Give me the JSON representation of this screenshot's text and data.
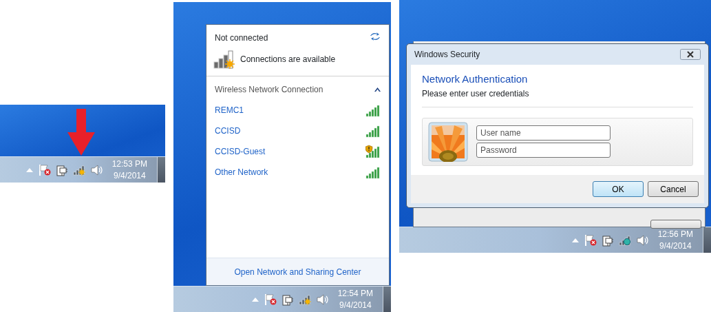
{
  "screens": [
    {
      "kind": "tray",
      "taskbar": {
        "network": {
          "kind": "available"
        },
        "time": "12:53 PM",
        "date": "9/4/2014"
      }
    },
    {
      "kind": "flyout",
      "flyout": {
        "status": "Not connected",
        "availability": "Connections are available",
        "section": {
          "title": "Wireless Network Connection",
          "expanded": true
        },
        "networks": [
          {
            "name": "REMC1",
            "warning": false
          },
          {
            "name": "CCISD",
            "warning": false
          },
          {
            "name": "CCISD-Guest",
            "warning": true
          },
          {
            "name": "Other Network",
            "warning": false
          }
        ],
        "footer_link": "Open Network and Sharing Center"
      },
      "taskbar": {
        "network": {
          "kind": "available"
        },
        "time": "12:54 PM",
        "date": "9/4/2014"
      }
    },
    {
      "kind": "dialog",
      "dialog": {
        "title": "Windows Security",
        "heading": "Network Authentication",
        "subtitle": "Please enter user credentials",
        "fields": [
          {
            "placeholder": "User name"
          },
          {
            "placeholder": "Password"
          }
        ],
        "buttons": [
          {
            "label": "OK",
            "default": true
          },
          {
            "label": "Cancel",
            "default": false
          }
        ]
      },
      "taskbar": {
        "network": {
          "kind": "connecting"
        },
        "time": "12:56 PM",
        "date": "9/4/2014"
      }
    }
  ]
}
